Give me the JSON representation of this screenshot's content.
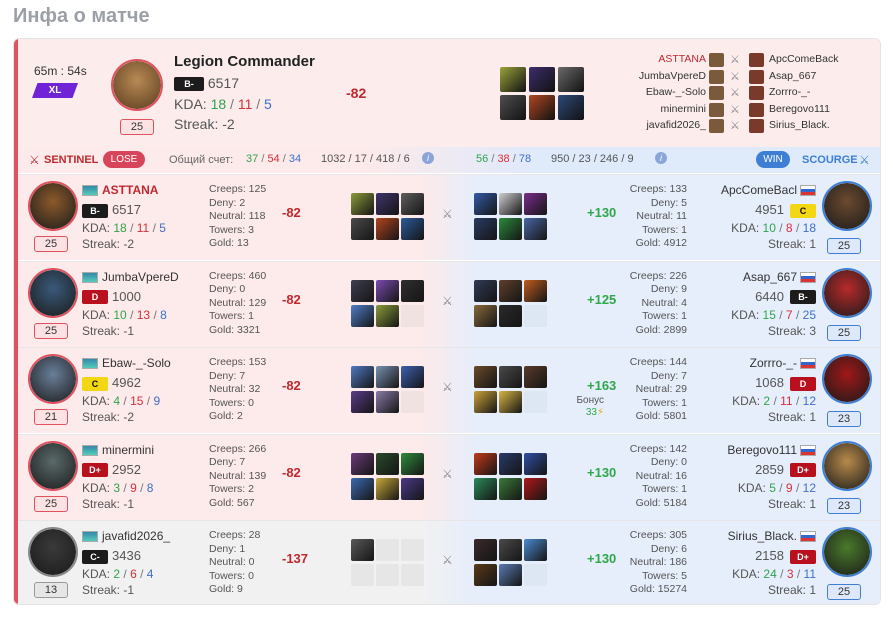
{
  "page_title": "Инфа о матче",
  "hero": {
    "duration": "65m : 54s",
    "badge": "XL",
    "name": "Legion Commander",
    "rank": "B-",
    "mmr": "6517",
    "kda_label": "KDA:",
    "kills": "18",
    "deaths": "11",
    "assists": "5",
    "streak": "Streak: -2",
    "level": "25",
    "delta": "-82",
    "items": [
      "#9aa33b",
      "#3d2e6c",
      "#6a6a6a",
      "#4f4f4f",
      "#b04722",
      "#2d4a7a"
    ],
    "lineup": [
      {
        "left": "ASTTANA",
        "right": "ApcComeBack",
        "highlight": true
      },
      {
        "left": "JumbaVpereD",
        "right": "Asap_667"
      },
      {
        "left": "Ebaw-_-Solo",
        "right": "Zorrro-_-"
      },
      {
        "left": "minermini",
        "right": "Beregovo111"
      },
      {
        "left": "javafid2026_",
        "right": "Sirius_Black."
      }
    ]
  },
  "teams": {
    "sentinel": "SENTINEL",
    "lose": "LOSE",
    "score_label": "Общий счет:",
    "s_k": "37",
    "s_d": "54",
    "s_a": "34",
    "s_other": "1032 / 17 / 418 / 6",
    "sc_k": "56",
    "sc_d": "38",
    "sc_a": "78",
    "sc_other": "950 / 23 / 246 / 9",
    "win": "WIN",
    "scourge": "SCOURGE",
    "info": "i"
  },
  "labels": {
    "kda": "KDA:",
    "bonus": "Бонус",
    "slash": "/"
  },
  "colors": {
    "sentinel": "#e05260",
    "scourge": "#3e7fd3",
    "positive": "#2ea84b",
    "negative": "#c0282f"
  },
  "rows": [
    {
      "left": {
        "name": "ASTTANA",
        "rank": "B-",
        "rankc": "",
        "mmr": "6517",
        "k": "18",
        "d": "11",
        "a": "5",
        "streak": "Streak: -2",
        "level": "25",
        "lvlc": "red",
        "avc": "#8b5a2b",
        "highlight": true,
        "creeps": "Creeps: 125",
        "deny": "Deny: 2",
        "neutral": "Neutral: 118",
        "towers": "Towers: 3",
        "gold": "Gold: 13",
        "delta": "-82",
        "items": [
          "#8b9a3a",
          "#41336e",
          "#5e5e5e",
          "#4a4a4a",
          "#b3441e",
          "#2b5b9a"
        ]
      },
      "right": {
        "name": "ApcComeBacl",
        "rank": "C",
        "rankc": "yel",
        "mmr": "4951",
        "k": "10",
        "d": "8",
        "a": "18",
        "streak": "Streak: 1",
        "level": "25",
        "avc": "#6b4a2f",
        "creeps": "Creeps: 133",
        "deny": "Deny: 5",
        "neutral": "Neutral: 11",
        "towers": "Towers: 1",
        "gold": "Gold: 4912",
        "delta": "+130",
        "items": [
          "#335aa5",
          "#cfcfcf",
          "#7a2d8e",
          "#2a3b63",
          "#2c8a3c",
          "#4a66a3"
        ]
      }
    },
    {
      "left": {
        "name": "JumbaVpereD",
        "rank": "D",
        "rankc": "red",
        "mmr": "1000",
        "k": "10",
        "d": "13",
        "a": "8",
        "streak": "Streak: -1",
        "level": "25",
        "lvlc": "red",
        "avc": "#3a5a7a",
        "creeps": "Creeps: 460",
        "deny": "Deny: 0",
        "neutral": "Neutral: 129",
        "towers": "Towers: 1",
        "gold": "Gold: 3321",
        "delta": "-82",
        "items": [
          "#3e3e50",
          "#7a4bb0",
          "#2f2f2f",
          "#4f7ec9",
          "#8a9b3a",
          ""
        ]
      },
      "right": {
        "name": "Asap_667",
        "rank": "B-",
        "rankc": "",
        "mmr": "6440",
        "k": "15",
        "d": "7",
        "a": "25",
        "streak": "Streak: 3",
        "level": "25",
        "avc": "#b82a2a",
        "creeps": "Creeps: 226",
        "deny": "Deny: 9",
        "neutral": "Neutral: 4",
        "towers": "Towers: 1",
        "gold": "Gold: 2899",
        "delta": "+125",
        "items": [
          "#303a55",
          "#5f3f2a",
          "#c05c1e",
          "#8a6a3a",
          "#2a2a2a",
          ""
        ]
      }
    },
    {
      "left": {
        "name": "Ebaw-_-Solo",
        "rank": "C",
        "rankc": "yel",
        "mmr": "4962",
        "k": "4",
        "d": "15",
        "a": "9",
        "streak": "Streak: -2",
        "level": "21",
        "lvlc": "red",
        "avc": "#6a7f9a",
        "creeps": "Creeps: 153",
        "deny": "Deny: 7",
        "neutral": "Neutral: 32",
        "towers": "Towers: 0",
        "gold": "Gold: 2",
        "delta": "-82",
        "items": [
          "#4e79c0",
          "#7a90b0",
          "#3d5fb0",
          "#5a3b8a",
          "#8a7aa8",
          ""
        ]
      },
      "right": {
        "name": "Zorrro-_-",
        "rank": "D",
        "rankc": "red",
        "mmr": "1068",
        "k": "2",
        "d": "11",
        "a": "12",
        "streak": "Streak: 1",
        "level": "23",
        "avc": "#a01818",
        "creeps": "Creeps: 144",
        "deny": "Deny: 7",
        "neutral": "Neutral: 29",
        "towers": "Towers: 1",
        "gold": "Gold: 5801",
        "delta": "+163",
        "bonus": "33",
        "items": [
          "#6b4a2a",
          "#4a4a4a",
          "#5a3a2a",
          "#c9a23a",
          "#d8b445",
          ""
        ]
      }
    },
    {
      "left": {
        "name": "minermini",
        "rank": "D+",
        "rankc": "red",
        "mmr": "2952",
        "k": "3",
        "d": "9",
        "a": "8",
        "streak": "Streak: -1",
        "level": "25",
        "lvlc": "red",
        "avc": "#5a6a6a",
        "creeps": "Creeps: 266",
        "deny": "Deny: 7",
        "neutral": "Neutral: 139",
        "towers": "Towers: 2",
        "gold": "Gold: 567",
        "delta": "-82",
        "items": [
          "#6a3a7a",
          "#2a4a2a",
          "#2e8b3e",
          "#3a6ab0",
          "#c8a83a",
          "#4a3a8a"
        ]
      },
      "right": {
        "name": "Beregovo111",
        "rank": "D+",
        "rankc": "red",
        "mmr": "2859",
        "k": "5",
        "d": "9",
        "a": "12",
        "streak": "Streak: 1",
        "level": "23",
        "avc": "#b88a4a",
        "creeps": "Creeps: 142",
        "deny": "Deny: 0",
        "neutral": "Neutral: 16",
        "towers": "Towers: 1",
        "gold": "Gold: 5184",
        "delta": "+130",
        "items": [
          "#c23a1a",
          "#2a3a6a",
          "#2f4fa0",
          "#2a8a5a",
          "#3a7a3a",
          "#b01818"
        ]
      }
    },
    {
      "left": {
        "name": "javafid2026_",
        "rank": "C-",
        "rankc": "",
        "mmr": "3436",
        "k": "2",
        "d": "6",
        "a": "4",
        "streak": "Streak: -1",
        "level": "13",
        "lvlc": "gray",
        "avc": "#3a3a3a",
        "gray": true,
        "creeps": "Creeps: 28",
        "deny": "Deny: 1",
        "neutral": "Neutral: 0",
        "towers": "Towers: 0",
        "gold": "Gold: 9",
        "delta": "-137",
        "items": [
          "#5a5a5a",
          "",
          "",
          "",
          "",
          ""
        ]
      },
      "right": {
        "name": "Sirius_Black.",
        "rank": "D+",
        "rankc": "red",
        "mmr": "2158",
        "k": "24",
        "d": "3",
        "a": "11",
        "streak": "Streak: 1",
        "level": "25",
        "avc": "#4a7a2a",
        "creeps": "Creeps: 305",
        "deny": "Deny: 6",
        "neutral": "Neutral: 186",
        "towers": "Towers: 5",
        "gold": "Gold: 15274",
        "delta": "+130",
        "items": [
          "#3a2a2a",
          "#4a4a4a",
          "#4a8ad0",
          "#5a3a1a",
          "#5a7ab0",
          ""
        ]
      }
    }
  ]
}
